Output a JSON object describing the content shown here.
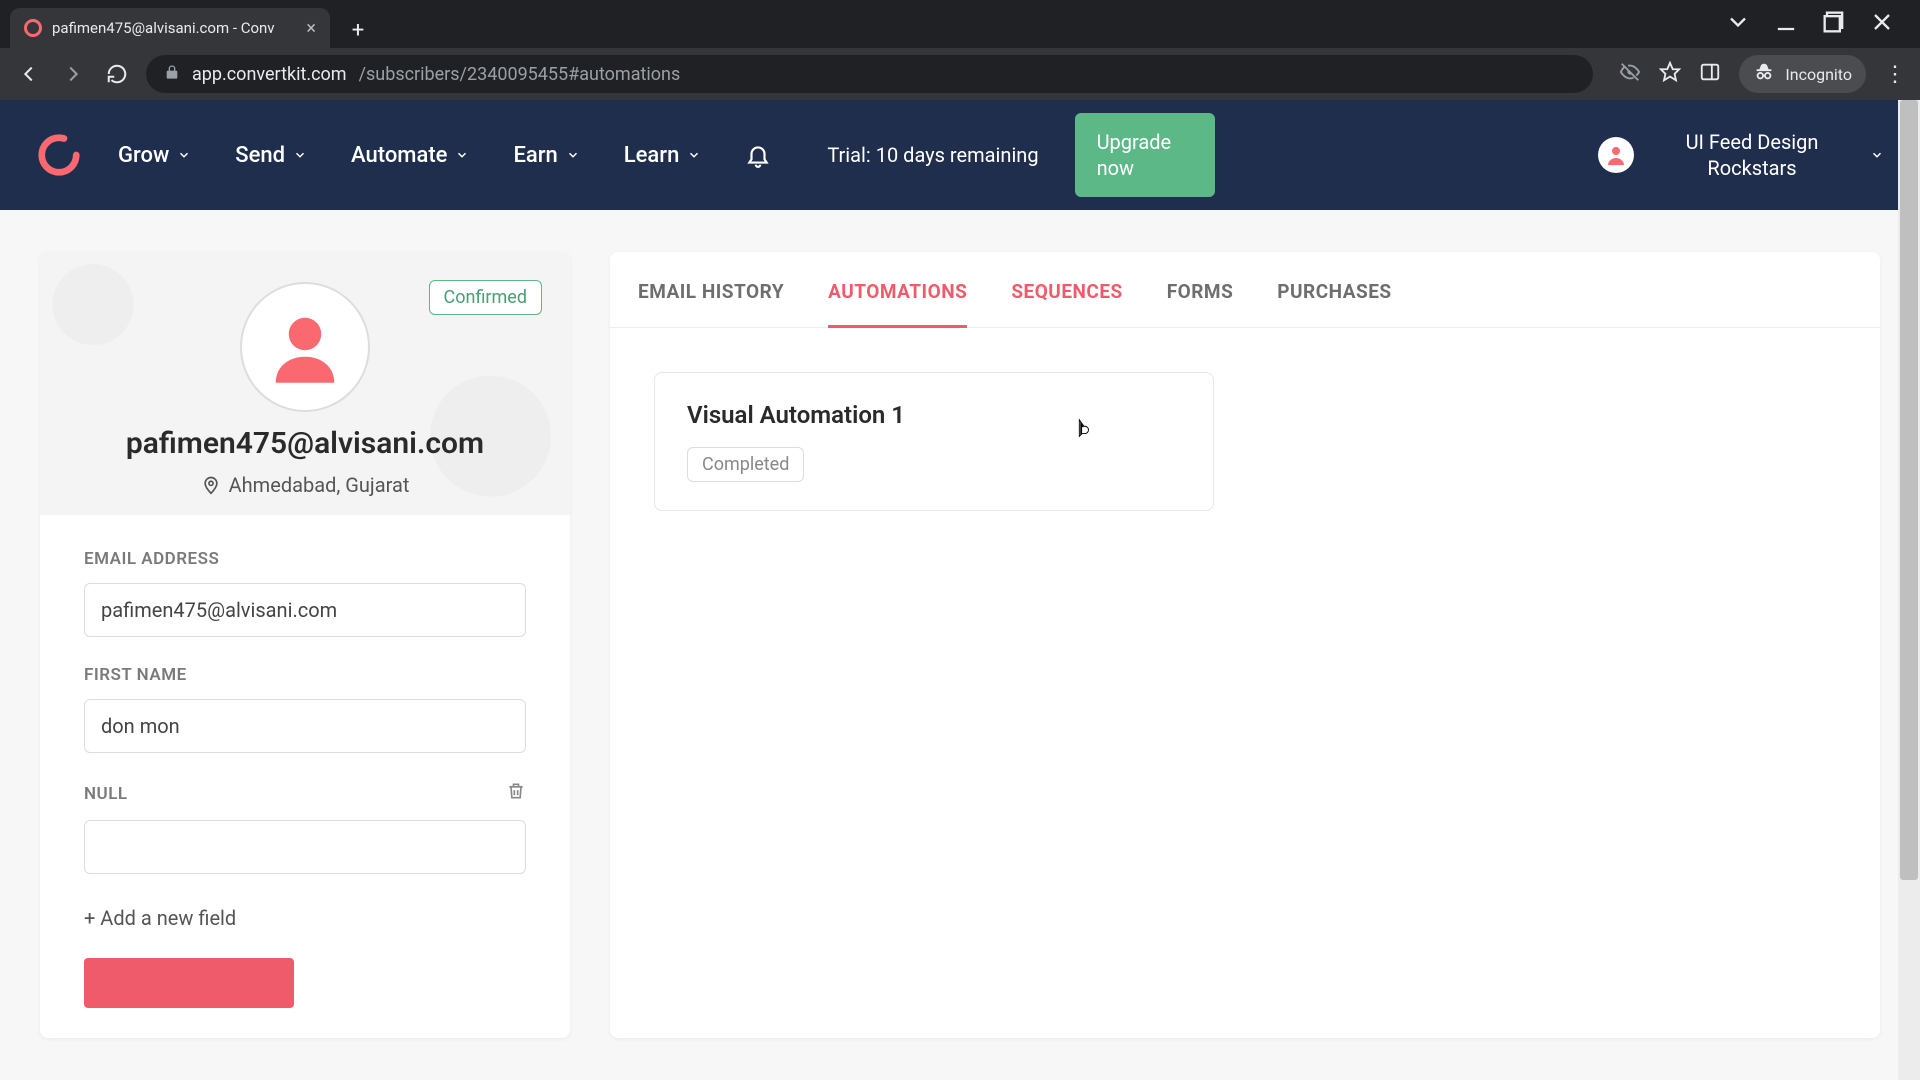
{
  "browser": {
    "tab_title": "pafimen475@alvisani.com - Conv",
    "url_host": "app.convertkit.com",
    "url_path": "/subscribers/2340095455#automations",
    "incognito_label": "Incognito"
  },
  "header": {
    "nav": {
      "grow": "Grow",
      "send": "Send",
      "automate": "Automate",
      "earn": "Earn",
      "learn": "Learn"
    },
    "trial_text": "Trial: 10 days remaining",
    "upgrade_label": "Upgrade now",
    "account_name": "UI Feed Design Rockstars"
  },
  "subscriber": {
    "status": "Confirmed",
    "email_display": "pafimen475@alvisani.com",
    "location": "Ahmedabad, Gujarat",
    "fields": {
      "email_label": "EMAIL ADDRESS",
      "email_value": "pafimen475@alvisani.com",
      "first_name_label": "FIRST NAME",
      "first_name_value": "don mon",
      "null_label": "NULL",
      "null_value": ""
    },
    "add_field_label": "+ Add a new field"
  },
  "tabs": {
    "email_history": "EMAIL HISTORY",
    "automations": "AUTOMATIONS",
    "sequences": "SEQUENCES",
    "forms": "FORMS",
    "purchases": "PURCHASES"
  },
  "automation_card": {
    "title": "Visual Automation 1",
    "status": "Completed"
  }
}
